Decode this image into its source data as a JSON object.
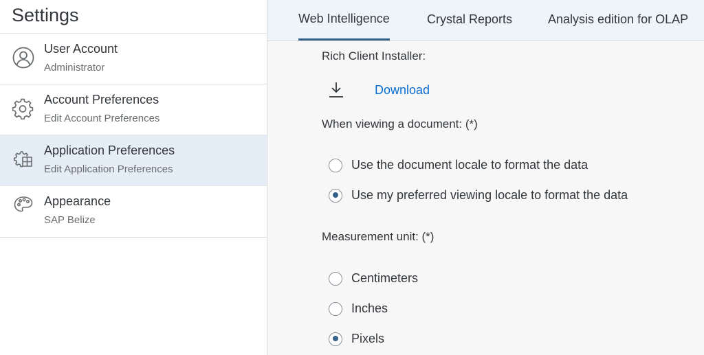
{
  "sidebar": {
    "title": "Settings",
    "items": [
      {
        "title": "User Account",
        "subtitle": "Administrator",
        "icon": "user-icon"
      },
      {
        "title": "Account Preferences",
        "subtitle": "Edit Account Preferences",
        "icon": "gear-icon"
      },
      {
        "title": "Application Preferences",
        "subtitle": "Edit Application Preferences",
        "icon": "app-settings-icon"
      },
      {
        "title": "Appearance",
        "subtitle": "SAP Belize",
        "icon": "palette-icon"
      }
    ],
    "selected_index": 2
  },
  "tabs": [
    {
      "label": "Web Intelligence",
      "active": true
    },
    {
      "label": "Crystal Reports",
      "active": false
    },
    {
      "label": "Analysis edition for OLAP",
      "active": false
    }
  ],
  "content": {
    "installer_label": "Rich Client Installer:",
    "download_label": "Download",
    "viewing_label": "When viewing a document: (*)",
    "viewing_options": [
      {
        "label": "Use the document locale to format the data",
        "checked": false
      },
      {
        "label": "Use my preferred viewing locale to format the data",
        "checked": true
      }
    ],
    "measurement_label": "Measurement unit: (*)",
    "measurement_options": [
      {
        "label": "Centimeters",
        "checked": false
      },
      {
        "label": "Inches",
        "checked": false
      },
      {
        "label": "Pixels",
        "checked": true
      }
    ]
  },
  "colors": {
    "accent": "#346187",
    "link": "#0a6ed1",
    "selected_bg": "#e5eef7",
    "tabbar_bg": "#eff4f9"
  }
}
